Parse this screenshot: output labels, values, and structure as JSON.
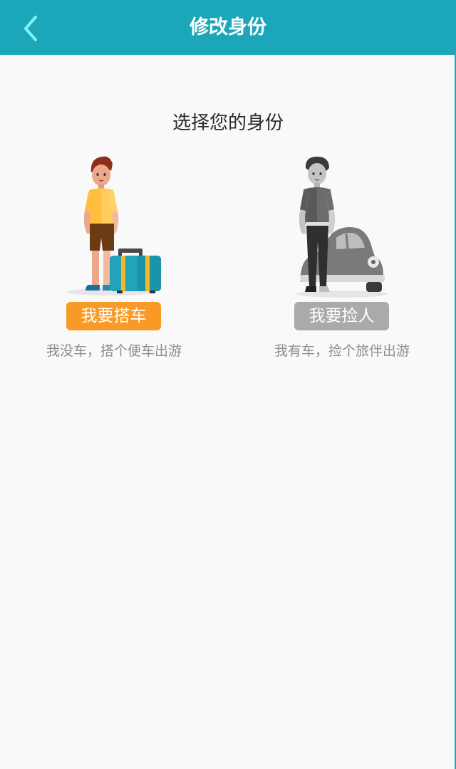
{
  "header": {
    "title": "修改身份",
    "back_icon": "chevron-left-icon",
    "background_color": "#1ba7b9"
  },
  "main": {
    "heading": "选择您的身份",
    "roles": [
      {
        "button_label": "我要搭车",
        "description": "我没车，搭个便车出游",
        "button_color": "#f99a28",
        "illustration": "traveler-with-suitcase-illustration"
      },
      {
        "button_label": "我要捡人",
        "description": "我有车，捡个旅伴出游",
        "button_color": "#aaaaaa",
        "illustration": "driver-with-car-illustration"
      }
    ]
  }
}
